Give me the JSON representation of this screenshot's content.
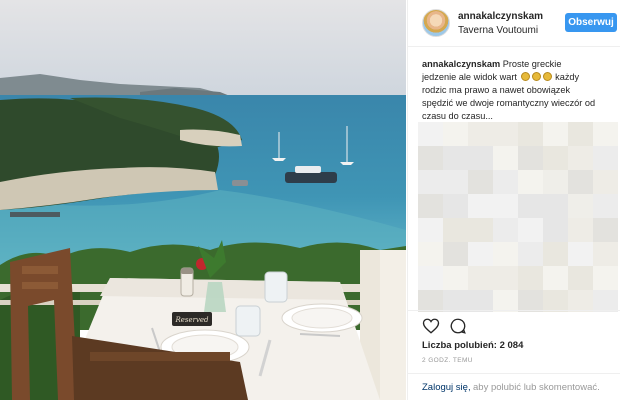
{
  "post": {
    "username": "annakalczynskam",
    "location": "Taverna Voutoumi",
    "follow_label": "Obserwuj",
    "caption_user": "annakalczynskam",
    "caption_lines": [
      "Proste greckie",
      "jedzenie ale widok wart",
      "każdy",
      "rodzic ma prawo a nawet obowiązek",
      "spędzić we dwoje romantyczny wieczór od",
      "czasu do czasu..."
    ],
    "likes": "Liczba polubień: 2 084",
    "time": "2 GODZ. TEMU",
    "login_link": "Zaloguj się,",
    "login_text": "aby polubić lub skomentować.",
    "table_sign": "Reserved"
  },
  "icons": {
    "like": "heart-icon",
    "comment": "comment-icon",
    "emoji": "smiley-emoji-icon"
  },
  "colors": {
    "follow_button": "#3897f0",
    "sea": "#3c8fb0",
    "sky": "#d8dde3"
  }
}
